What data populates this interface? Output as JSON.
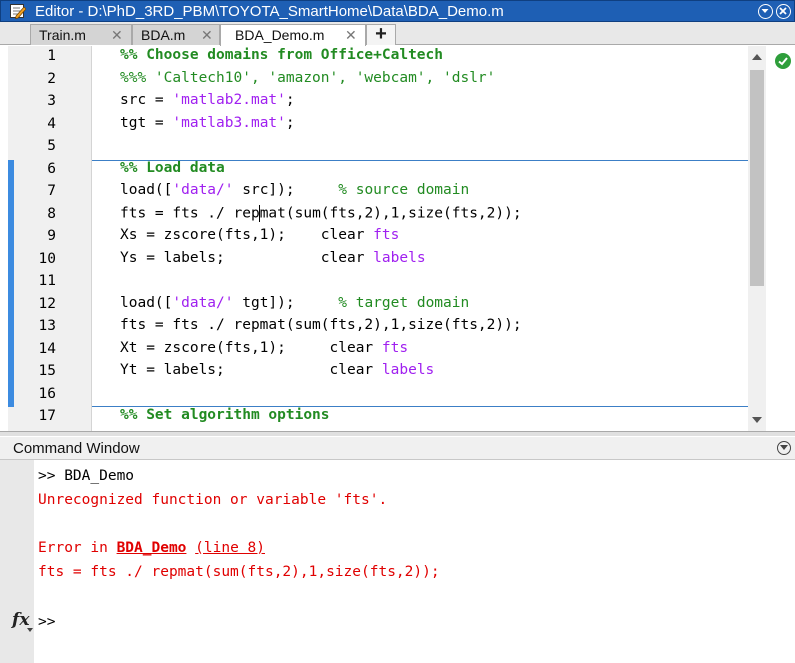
{
  "window": {
    "title": "Editor - D:\\PhD_3RD_PBM\\TOYOTA_SmartHome\\Data\\BDA_Demo.m"
  },
  "tabs": [
    {
      "label": "Train.m",
      "close": "✕"
    },
    {
      "label": "BDA.m",
      "close": "✕"
    },
    {
      "label": "BDA_Demo.m",
      "close": "✕",
      "active": true
    }
  ],
  "new_tab_label": "+",
  "editor": {
    "lines": [
      {
        "n": "1",
        "seg": [
          {
            "t": "%% Choose domains from Office+Caltech",
            "c": "com"
          }
        ]
      },
      {
        "n": "2",
        "seg": [
          {
            "t": "%%% 'Caltech10', 'amazon', 'webcam', 'dslr'",
            "c": "cm"
          }
        ]
      },
      {
        "n": "3",
        "seg": [
          {
            "t": "src = "
          },
          {
            "t": "'matlab2.mat'",
            "c": "str"
          },
          {
            "t": ";"
          }
        ]
      },
      {
        "n": "4",
        "seg": [
          {
            "t": "tgt = "
          },
          {
            "t": "'matlab3.mat'",
            "c": "str"
          },
          {
            "t": ";"
          }
        ]
      },
      {
        "n": "5",
        "seg": []
      },
      {
        "n": "6",
        "seg": [
          {
            "t": "%% Load data",
            "c": "com"
          }
        ]
      },
      {
        "n": "7",
        "seg": [
          {
            "t": "load(["
          },
          {
            "t": "'data/'",
            "c": "str"
          },
          {
            "t": " src]);     "
          },
          {
            "t": "% source domain",
            "c": "cm"
          }
        ]
      },
      {
        "n": "8",
        "seg": [
          {
            "t": "fts = fts ./ rep"
          },
          {
            "caret": true
          },
          {
            "t": "mat(sum(fts,2),1,size(fts,2));"
          }
        ]
      },
      {
        "n": "9",
        "seg": [
          {
            "t": "Xs = zscore(fts,1);    clear "
          },
          {
            "t": "fts",
            "c": "str"
          }
        ]
      },
      {
        "n": "10",
        "seg": [
          {
            "t": "Ys = labels;           clear "
          },
          {
            "t": "labels",
            "c": "str"
          }
        ]
      },
      {
        "n": "11",
        "seg": []
      },
      {
        "n": "12",
        "seg": [
          {
            "t": "load(["
          },
          {
            "t": "'data/'",
            "c": "str"
          },
          {
            "t": " tgt]);     "
          },
          {
            "t": "% target domain",
            "c": "cm"
          }
        ]
      },
      {
        "n": "13",
        "seg": [
          {
            "t": "fts = fts ./ repmat(sum(fts,2),1,size(fts,2));"
          }
        ]
      },
      {
        "n": "14",
        "seg": [
          {
            "t": "Xt = zscore(fts,1);     clear "
          },
          {
            "t": "fts",
            "c": "str"
          }
        ]
      },
      {
        "n": "15",
        "seg": [
          {
            "t": "Yt = labels;            clear "
          },
          {
            "t": "labels",
            "c": "str"
          }
        ]
      },
      {
        "n": "16",
        "seg": []
      },
      {
        "n": "17",
        "seg": [
          {
            "t": "%% Set algorithm options",
            "c": "com"
          }
        ]
      }
    ]
  },
  "command_window": {
    "title": "Command Window",
    "lines": [
      {
        "seg": [
          {
            "t": ">> BDA_Demo"
          }
        ]
      },
      {
        "seg": [
          {
            "t": "Unrecognized function or variable 'fts'.",
            "c": "err"
          }
        ]
      },
      {
        "seg": []
      },
      {
        "seg": [
          {
            "t": "Error in ",
            "c": "err"
          },
          {
            "t": "BDA_Demo",
            "c": "err-fn"
          },
          {
            "t": " ",
            "c": "err"
          },
          {
            "t": "(line 8)",
            "c": "err-link"
          }
        ]
      },
      {
        "seg": [
          {
            "t": "fts = fts ./ repmat(sum(fts,2),1,size(fts,2));",
            "c": "err"
          }
        ]
      }
    ],
    "prompt": ">>",
    "fx_label": "fx"
  },
  "colors": {
    "title_bar": "#1e5fb4",
    "keyword_comment": "#228b22",
    "string": "#a020f0",
    "error": "#e00000",
    "cell_marker": "#3c8be0"
  }
}
